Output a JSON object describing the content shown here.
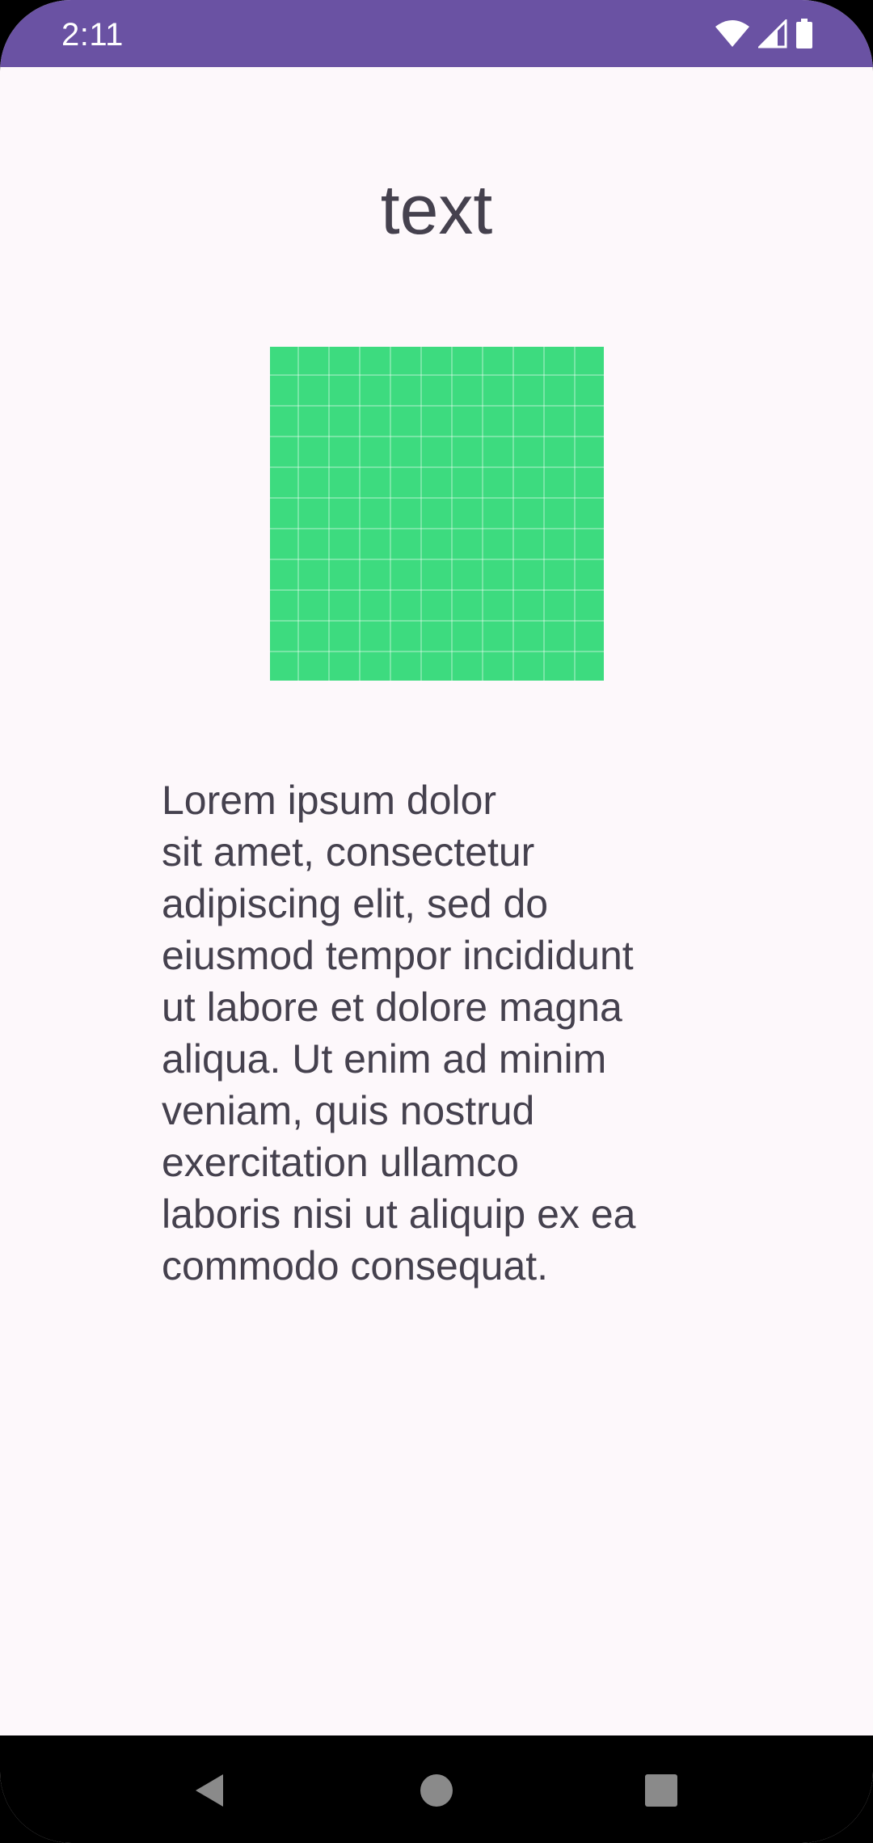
{
  "status_bar": {
    "time": "2:11",
    "icons": [
      "wifi-icon",
      "signal-icon",
      "battery-icon"
    ],
    "background": "#6a52a3"
  },
  "main": {
    "title": "text",
    "image": {
      "icon": "grid-placeholder-image",
      "color": "#3ddb7f"
    },
    "body": "Lorem ipsum dolor\nsit amet, consectetur\nadipiscing elit, sed do\neiusmod tempor incididunt\nut labore et dolore magna\naliqua. Ut enim ad minim\nveniam, quis nostrud\nexercitation ullamco\nlaboris nisi ut aliquip ex ea\ncommodo consequat."
  },
  "nav_bar": {
    "buttons": [
      "back-icon",
      "home-icon",
      "recents-icon"
    ]
  }
}
